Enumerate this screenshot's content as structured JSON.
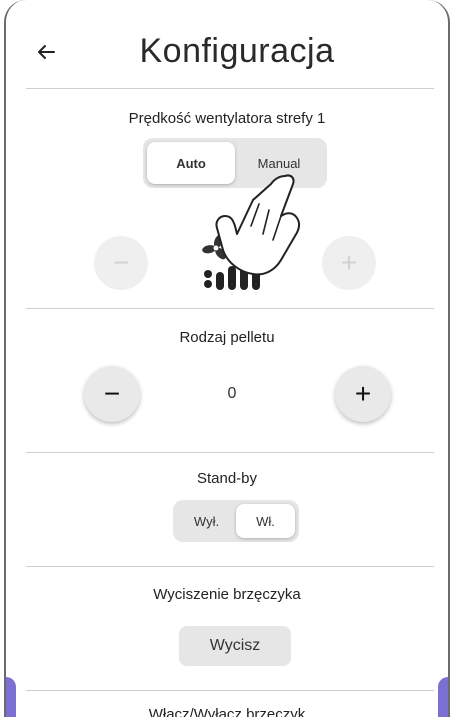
{
  "header": {
    "back_icon": "arrow-left-icon",
    "title": "Konfiguracja"
  },
  "fan_speed": {
    "title": "Prędkość wentylatora strefy 1",
    "modes": [
      "Auto",
      "Manual"
    ],
    "selected": "Auto",
    "minus": "−",
    "plus": "+",
    "level_icon": "fan-speed-icon"
  },
  "pellet": {
    "title": "Rodzaj pelletu",
    "minus": "−",
    "plus": "+",
    "value": "0"
  },
  "standby": {
    "title": "Stand-by",
    "options": [
      "Wył.",
      "Wł."
    ],
    "selected": "Wł."
  },
  "buzzer": {
    "title": "Wyciszenie brzęczyka",
    "button": "Wycisz"
  },
  "next_section": {
    "title": "Włącz/Wyłącz brzęczyk"
  },
  "colors": {
    "accent": "#7b6fd1",
    "divider": "#cfcfcf",
    "button_bg": "#e6e6e6"
  }
}
